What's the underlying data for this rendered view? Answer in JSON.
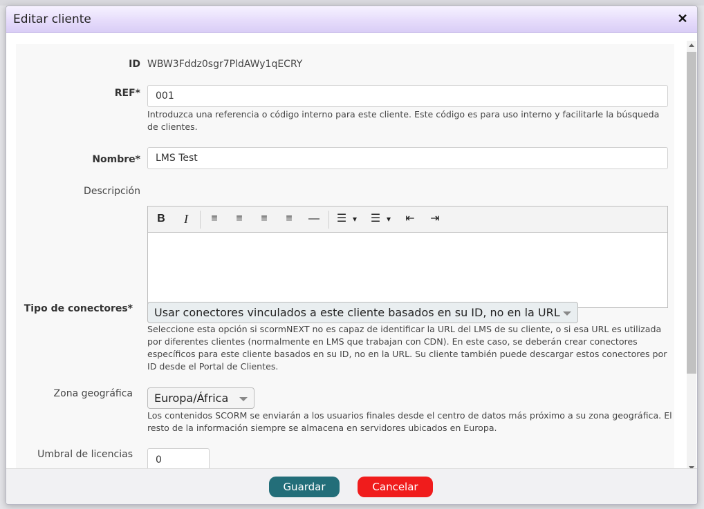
{
  "dialog": {
    "title": "Editar cliente",
    "close_label": "✕"
  },
  "fields": {
    "id": {
      "label": "ID",
      "value": "WBW3Fddz0sgr7PldAWy1qECRY"
    },
    "ref": {
      "label": "REF*",
      "value": "001",
      "help": "Introduzca una referencia o código interno para este cliente. Este código es para uso interno y facilitarle la búsqueda de clientes."
    },
    "nombre": {
      "label": "Nombre*",
      "value": "LMS Test"
    },
    "descripcion": {
      "label": "Descripción",
      "value": ""
    },
    "tipo": {
      "label": "Tipo de conectores*",
      "selected": "Usar conectores vinculados a este cliente basados en su ID, no en la URL",
      "help": "Seleccione esta opción si scormNEXT no es capaz de identificar la URL del LMS de su cliente, o si esa URL es utilizada por diferentes clientes (normalmente en LMS que trabajan con CDN). En este caso, se deberán crear conectores específicos para este cliente basados en su ID, no en la URL. Su cliente también puede descargar estos conectores por ID desde el Portal de Clientes."
    },
    "zona": {
      "label": "Zona geográfica",
      "selected": "Europa/África",
      "help": "Los contenidos SCORM se enviarán a los usuarios finales desde el centro de datos más próximo a su zona geográfica. El resto de la información siempre se almacena en servidores ubicados en Europa."
    },
    "umbral": {
      "label": "Umbral de licencias",
      "value": "0"
    }
  },
  "toolbar": {
    "bold": "B",
    "italic": "I",
    "align_left": "≡",
    "align_center": "≡",
    "align_right": "≡",
    "justify": "≡",
    "hr": "—",
    "bullets": "☰",
    "numbered": "☰",
    "dropdown": "▾",
    "outdent": "⇤",
    "indent": "⇥"
  },
  "footer": {
    "save_label": "Guardar",
    "cancel_label": "Cancelar"
  },
  "colors": {
    "save": "#236e79",
    "cancel": "#f01c1c",
    "title_bar": "#e6dcfb"
  }
}
